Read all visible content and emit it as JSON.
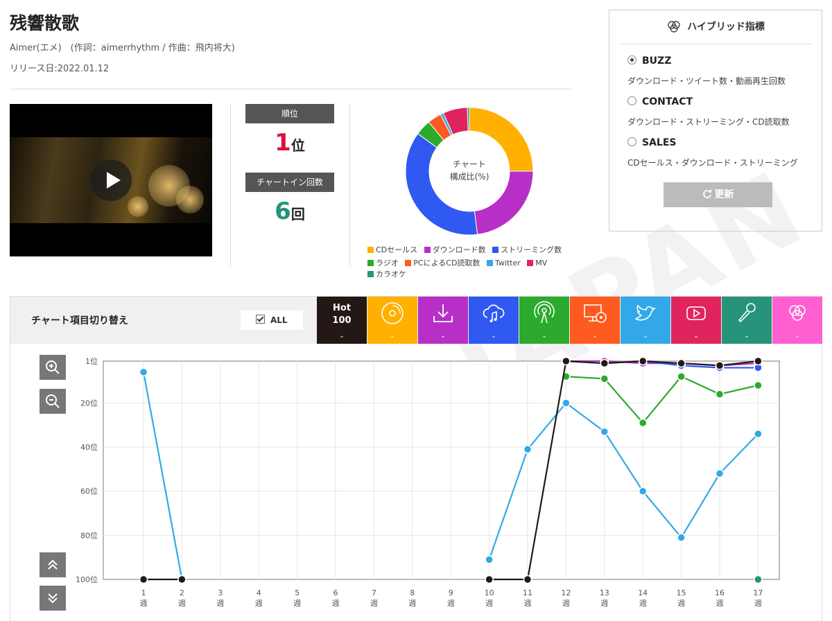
{
  "song": {
    "title": "残響散歌",
    "meta": "Aimer(エメ)　(作詞：aimerrhythm / 作曲：飛内将大)",
    "release": "リリース日:2022.01.12"
  },
  "watermark": "JAPAN",
  "stats": {
    "rank_label": "順位",
    "rank_value": "1",
    "rank_unit": "位",
    "chartin_label": "チャートイン回数",
    "chartin_value": "6",
    "chartin_unit": "回"
  },
  "donut": {
    "center_line1": "チャート",
    "center_line2": "構成比(%)",
    "segments": [
      {
        "name": "CDセールス",
        "value": 25,
        "color": "#FFB000"
      },
      {
        "name": "ダウンロード数",
        "value": 23,
        "color": "#B72FC6"
      },
      {
        "name": "ストリーミング数",
        "value": 37,
        "color": "#2F59F0"
      },
      {
        "name": "ラジオ",
        "value": 4,
        "color": "#2BAA2E"
      },
      {
        "name": "PCによるCD読取数",
        "value": 3.5,
        "color": "#FF5A1F"
      },
      {
        "name": "Twitter",
        "value": 0.8,
        "color": "#33A8E8"
      },
      {
        "name": "MV",
        "value": 6.2,
        "color": "#E0245E"
      },
      {
        "name": "カラオケ",
        "value": 0.5,
        "color": "#26937A"
      }
    ]
  },
  "legend": [
    {
      "label": "CDセールス",
      "color": "#FFB000"
    },
    {
      "label": "ダウンロード数",
      "color": "#B72FC6"
    },
    {
      "label": "ストリーミング数",
      "color": "#2F59F0"
    },
    {
      "label": "ラジオ",
      "color": "#2BAA2E"
    },
    {
      "label": "PCによるCD読取数",
      "color": "#FF5A1F"
    },
    {
      "label": "Twitter",
      "color": "#33A8E8"
    },
    {
      "label": "MV",
      "color": "#E0245E"
    },
    {
      "label": "カラオケ",
      "color": "#26937A"
    }
  ],
  "hybrid": {
    "title": "ハイブリッド指標",
    "options": [
      {
        "label": "BUZZ",
        "desc": "ダウンロード・ツイート数・動画再生回数",
        "selected": true
      },
      {
        "label": "CONTACT",
        "desc": "ダウンロード・ストリーミング・CD読取数",
        "selected": false
      },
      {
        "label": "SALES",
        "desc": "CDセールス・ダウンロード・ストリーミング",
        "selected": false
      }
    ],
    "refresh": "更新"
  },
  "switcher": {
    "title": "チャート項目切り替え",
    "all_label": "ALL",
    "hot_line1": "Hot",
    "hot_line2": "100",
    "tabs": [
      {
        "icon": "hot100",
        "color": "#231815"
      },
      {
        "icon": "cd-icon",
        "color": "#FFB000"
      },
      {
        "icon": "download-icon",
        "color": "#B72FC6"
      },
      {
        "icon": "streaming-icon",
        "color": "#2F59F0"
      },
      {
        "icon": "radio-icon",
        "color": "#2BAA2E"
      },
      {
        "icon": "pc-cd-icon",
        "color": "#FF5A1F"
      },
      {
        "icon": "twitter-icon",
        "color": "#33A8E8"
      },
      {
        "icon": "youtube-icon",
        "color": "#E0245E"
      },
      {
        "icon": "karaoke-icon",
        "color": "#26937A"
      },
      {
        "icon": "hybrid-icon",
        "color": "#FF5FD0"
      }
    ]
  },
  "chart_data": {
    "type": "line",
    "x": [
      "1",
      "2",
      "3",
      "4",
      "5",
      "6",
      "7",
      "8",
      "9",
      "10",
      "11",
      "12",
      "13",
      "14",
      "15",
      "16",
      "17"
    ],
    "x_unit": "週",
    "y_ticks": [
      "1位",
      "20位",
      "40位",
      "60位",
      "80位",
      "100位"
    ],
    "ylim": [
      1,
      100
    ],
    "y_inverted": true,
    "series": [
      {
        "color": "#33A8E8",
        "values": [
          6,
          100,
          null,
          null,
          null,
          null,
          null,
          null,
          null,
          91,
          41,
          20,
          33,
          60,
          81,
          52,
          34
        ]
      },
      {
        "color": "#2BAA2E",
        "values": [
          null,
          null,
          null,
          null,
          null,
          null,
          null,
          null,
          null,
          null,
          null,
          8,
          9,
          29,
          8,
          16,
          12
        ]
      },
      {
        "color": "#B72FC6",
        "values": [
          null,
          null,
          null,
          null,
          null,
          null,
          null,
          null,
          null,
          null,
          null,
          1,
          1,
          2,
          2,
          3,
          2
        ]
      },
      {
        "color": "#2F59F0",
        "values": [
          null,
          null,
          null,
          null,
          null,
          null,
          null,
          null,
          null,
          null,
          null,
          1,
          2,
          1,
          3,
          4,
          4
        ]
      },
      {
        "color": "#26937A",
        "values": [
          null,
          null,
          null,
          null,
          null,
          null,
          null,
          null,
          null,
          null,
          null,
          null,
          null,
          null,
          null,
          null,
          100
        ]
      },
      {
        "color": "#231815",
        "values": [
          100,
          100,
          null,
          null,
          null,
          null,
          null,
          null,
          null,
          100,
          100,
          1,
          2,
          1,
          2,
          3,
          1
        ]
      }
    ]
  }
}
